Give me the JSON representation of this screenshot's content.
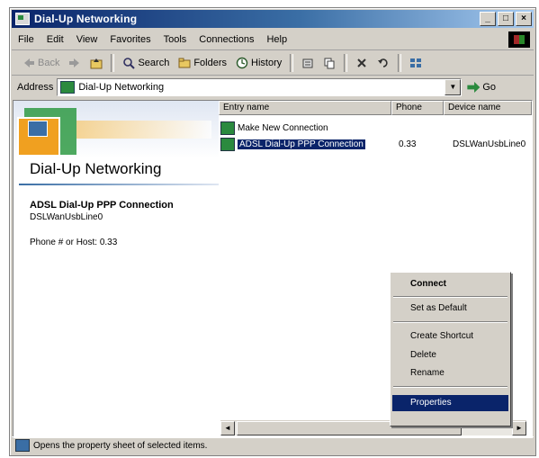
{
  "window": {
    "title": "Dial-Up Networking"
  },
  "menubar": {
    "items": [
      "File",
      "Edit",
      "View",
      "Favorites",
      "Tools",
      "Connections",
      "Help"
    ]
  },
  "toolbar": {
    "back_label": "Back",
    "search_label": "Search",
    "folders_label": "Folders",
    "history_label": "History"
  },
  "address": {
    "label": "Address",
    "value": "Dial-Up Networking",
    "go_label": "Go"
  },
  "left_pane": {
    "title": "Dial-Up Networking",
    "conn_name": "ADSL Dial-Up PPP Connection",
    "device": "DSLWanUsbLine0",
    "phone": "Phone # or Host: 0.33"
  },
  "list": {
    "columns": [
      "Entry name",
      "Phone",
      "Device name"
    ],
    "rows": [
      {
        "name": "Make New Connection",
        "phone": "",
        "device": ""
      },
      {
        "name": "ADSL Dial-Up PPP Connection",
        "phone": "0.33",
        "device": "DSLWanUsbLine0"
      }
    ]
  },
  "context_menu": {
    "items": [
      "Connect",
      "Set as Default",
      "Create Shortcut",
      "Delete",
      "Rename",
      "Properties"
    ]
  },
  "statusbar": {
    "text": "Opens the property sheet of selected items."
  }
}
